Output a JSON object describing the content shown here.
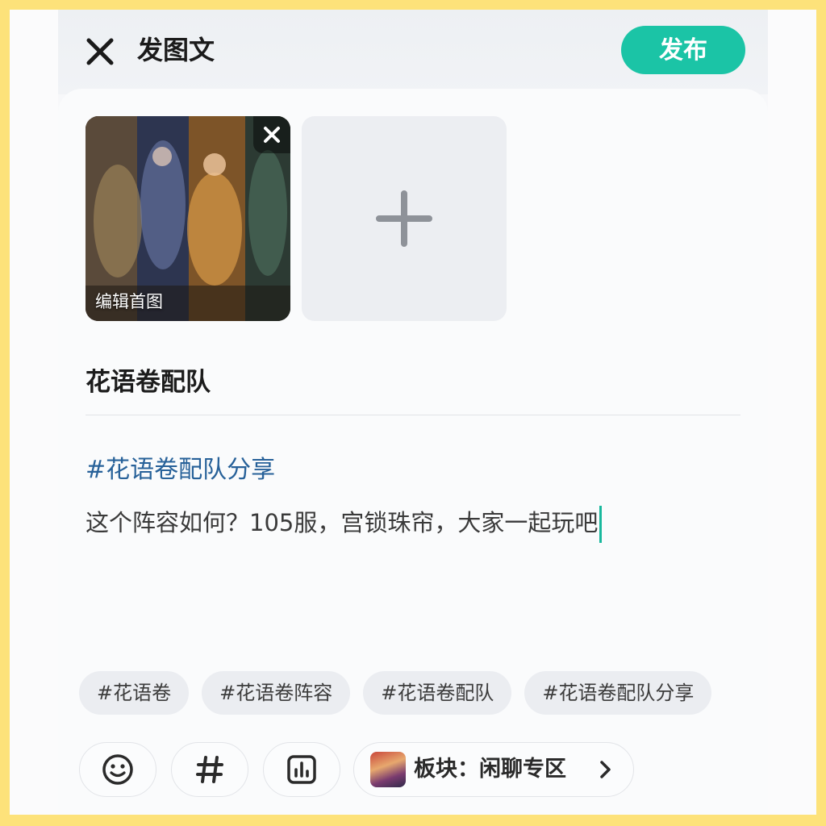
{
  "header": {
    "title": "发图文",
    "publish_label": "发布",
    "accent_color": "#1bc4a6"
  },
  "media": {
    "thumbnail_caption": "编辑首图"
  },
  "post": {
    "title": "花语卷配队",
    "hashtag": "#花语卷配队分享",
    "body": "这个阵容如何？105服，宫锁珠帘，大家一起玩吧"
  },
  "suggested_tags": [
    "#花语卷",
    "#花语卷阵容",
    "#花语卷配队",
    "#花语卷配队分享"
  ],
  "toolbar": {
    "emoji_icon": "emoji-icon",
    "hashtag_icon": "hashtag-icon",
    "chart_icon": "chart-icon",
    "board_label": "板块：闲聊专区"
  }
}
